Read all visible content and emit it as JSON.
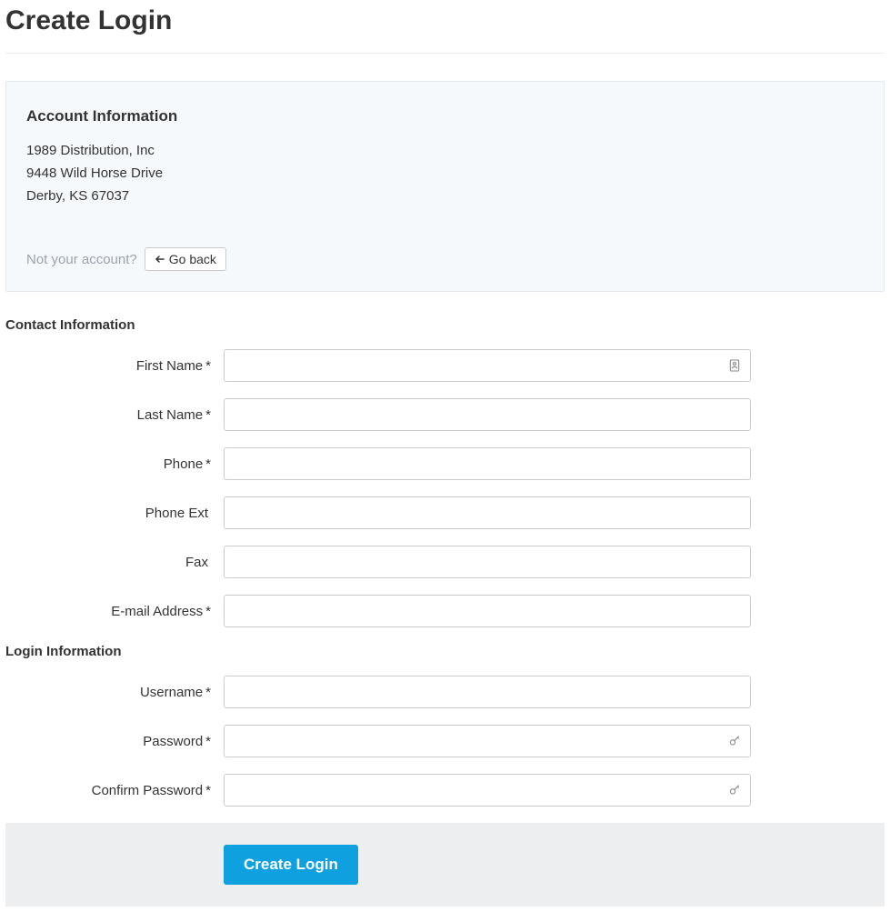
{
  "page": {
    "title": "Create Login"
  },
  "account": {
    "heading": "Account Information",
    "company": "1989 Distribution, Inc",
    "street": "9448 Wild Horse Drive",
    "city_state_zip": "Derby, KS 67037",
    "not_your_text": "Not your account?",
    "go_back_label": "Go back"
  },
  "contact_section": {
    "heading": "Contact Information",
    "fields": {
      "first_name": {
        "label": "First Name",
        "required": "*",
        "value": ""
      },
      "last_name": {
        "label": "Last Name",
        "required": "*",
        "value": ""
      },
      "phone": {
        "label": "Phone",
        "required": "*",
        "value": ""
      },
      "phone_ext": {
        "label": "Phone Ext",
        "required": "",
        "value": ""
      },
      "fax": {
        "label": "Fax",
        "required": "",
        "value": ""
      },
      "email": {
        "label": "E-mail Address",
        "required": "*",
        "value": ""
      }
    }
  },
  "login_section": {
    "heading": "Login Information",
    "fields": {
      "username": {
        "label": "Username",
        "required": "*",
        "value": ""
      },
      "password": {
        "label": "Password",
        "required": "*",
        "value": ""
      },
      "confirm_password": {
        "label": "Confirm Password",
        "required": "*",
        "value": ""
      }
    }
  },
  "actions": {
    "submit_label": "Create Login"
  },
  "icons": {
    "contact_card": "contact-card-icon",
    "key": "key-icon",
    "arrow_left": "arrow-left-icon"
  }
}
